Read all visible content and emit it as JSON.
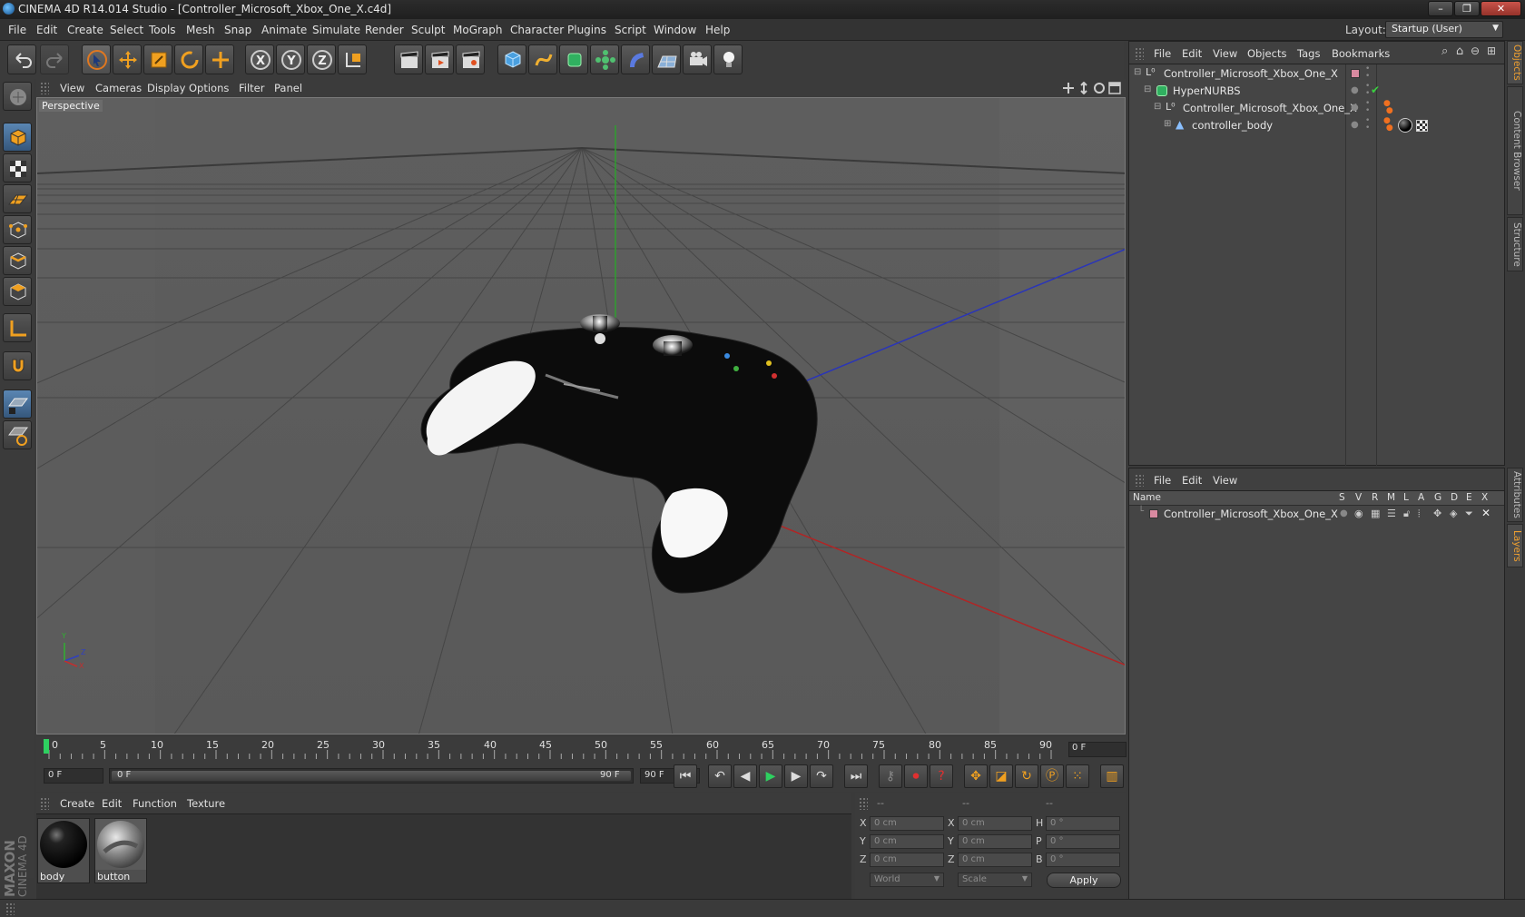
{
  "window": {
    "title": "CINEMA 4D R14.014 Studio - [Controller_Microsoft_Xbox_One_X.c4d]",
    "controls": [
      "–",
      "❐",
      "✕"
    ]
  },
  "menubar": {
    "items": [
      "File",
      "Edit",
      "Create",
      "Select",
      "Tools",
      "Mesh",
      "Snap",
      "Animate",
      "Simulate",
      "Render",
      "Sculpt",
      "MoGraph",
      "Character",
      "Plugins",
      "Script",
      "Window",
      "Help"
    ],
    "layout_label": "Layout:",
    "layout_value": "Startup (User)"
  },
  "viewport": {
    "menu": [
      "View",
      "Cameras",
      "Display",
      "Options",
      "Filter",
      "Panel"
    ],
    "label": "Perspective",
    "axis_labels": {
      "y": "Y",
      "z": "Z",
      "x": "X"
    }
  },
  "timeline": {
    "ticks": [
      "0",
      "5",
      "10",
      "15",
      "20",
      "25",
      "30",
      "35",
      "40",
      "45",
      "50",
      "55",
      "60",
      "65",
      "70",
      "75",
      "80",
      "85",
      "90"
    ],
    "current_frame": "0 F",
    "start_frame": "0 F",
    "range_start": "0 F",
    "range_end": "90 F",
    "end_frame": "90 F"
  },
  "materials": {
    "menu": [
      "Create",
      "Edit",
      "Function",
      "Texture"
    ],
    "items": [
      {
        "name": "body",
        "kind": "glossy-black"
      },
      {
        "name": "button",
        "kind": "chrome"
      }
    ]
  },
  "coordinates": {
    "headers": [
      "--",
      "--",
      "--"
    ],
    "rows": [
      {
        "l1": "X",
        "v1": "0 cm",
        "l2": "X",
        "v2": "0 cm",
        "l3": "H",
        "v3": "0 °"
      },
      {
        "l1": "Y",
        "v1": "0 cm",
        "l2": "Y",
        "v2": "0 cm",
        "l3": "P",
        "v3": "0 °"
      },
      {
        "l1": "Z",
        "v1": "0 cm",
        "l2": "Z",
        "v2": "0 cm",
        "l3": "B",
        "v3": "0 °"
      }
    ],
    "space": "World",
    "mode": "Scale",
    "apply": "Apply"
  },
  "objects": {
    "menu": [
      "File",
      "Edit",
      "View",
      "Objects",
      "Tags",
      "Bookmarks"
    ],
    "tree": [
      {
        "name": "Controller_Microsoft_Xbox_One_X",
        "icon": "null-object-icon"
      },
      {
        "name": "HyperNURBS",
        "icon": "hypernurbs-icon"
      },
      {
        "name": "Controller_Microsoft_Xbox_One_X",
        "icon": "null-object-icon"
      },
      {
        "name": "controller_body",
        "icon": "polygon-object-icon"
      }
    ]
  },
  "layers": {
    "menu": [
      "File",
      "Edit",
      "View"
    ],
    "columns": [
      "Name",
      "S",
      "V",
      "R",
      "M",
      "L",
      "A",
      "G",
      "D",
      "E",
      "X"
    ],
    "rows": [
      {
        "name": "Controller_Microsoft_Xbox_One_X",
        "color": "#d98aa0"
      }
    ]
  },
  "right_tabs": [
    "Objects",
    "Content Browser",
    "Structure",
    "Attributes",
    "Layers"
  ],
  "brand": {
    "line1": "MAXON",
    "line2": "CINEMA 4D"
  },
  "colors": {
    "accent": "#f0a030",
    "viewport_bg": "#5c5c5c",
    "x_axis": "#c03030",
    "y_axis": "#30b030",
    "z_axis": "#3040c0"
  }
}
